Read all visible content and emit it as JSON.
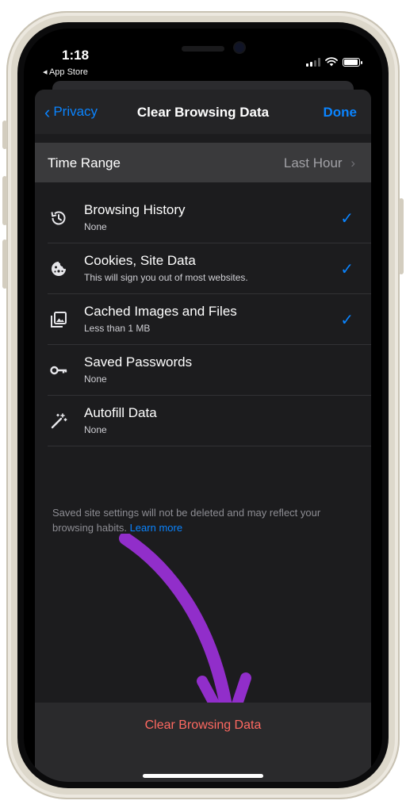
{
  "status_bar": {
    "time": "1:18",
    "back_app": "◂ App Store",
    "battery_level": 0.9,
    "signal_bars": 2
  },
  "nav": {
    "back_label": "Privacy",
    "title": "Clear Browsing Data",
    "done_label": "Done"
  },
  "time_range": {
    "label": "Time Range",
    "value": "Last Hour"
  },
  "items": [
    {
      "title": "Browsing History",
      "subtitle": "None",
      "icon": "history-icon",
      "checked": true
    },
    {
      "title": "Cookies, Site Data",
      "subtitle": "This will sign you out of most websites.",
      "icon": "cookie-icon",
      "checked": true
    },
    {
      "title": "Cached Images and Files",
      "subtitle": "Less than 1 MB",
      "icon": "images-icon",
      "checked": true
    },
    {
      "title": "Saved Passwords",
      "subtitle": "None",
      "icon": "key-icon",
      "checked": false
    },
    {
      "title": "Autofill Data",
      "subtitle": "None",
      "icon": "magic-wand-icon",
      "checked": false
    }
  ],
  "footer": {
    "note": "Saved site settings will not be deleted and may reflect your browsing habits.",
    "link": "Learn more"
  },
  "clear_button": "Clear Browsing Data",
  "colors": {
    "accent": "#0a84ff",
    "destructive": "#ff6961",
    "annotation_arrow": "#9b30d9"
  }
}
